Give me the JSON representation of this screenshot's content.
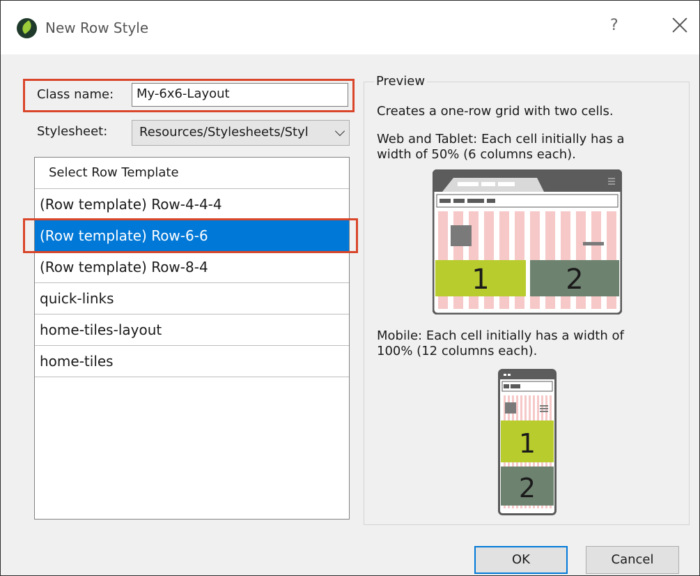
{
  "window": {
    "title": "New Row Style",
    "help_label": "?"
  },
  "form": {
    "class_name_label": "Class name:",
    "class_name_value": "My-6x6-Layout",
    "stylesheet_label": "Stylesheet:",
    "stylesheet_value": "Resources/Stylesheets/Styl"
  },
  "template_list": {
    "header": "Select Row Template",
    "items": [
      {
        "label": "(Row template) Row-4-4-4",
        "selected": false
      },
      {
        "label": "(Row template) Row-6-6",
        "selected": true
      },
      {
        "label": "(Row template) Row-8-4",
        "selected": false
      },
      {
        "label": "quick-links",
        "selected": false
      },
      {
        "label": "home-tiles-layout",
        "selected": false
      },
      {
        "label": "home-tiles",
        "selected": false
      }
    ]
  },
  "preview": {
    "legend": "Preview",
    "description": "Creates a one-row grid with two cells.",
    "web_line1": "Web and Tablet: Each cell initially has a",
    "web_line2": "width of 50% (6 columns each).",
    "mobile_line1": "Mobile: Each cell initially has a width of",
    "mobile_line2": "100% (12 columns each).",
    "cell_1": "1",
    "cell_2": "2"
  },
  "buttons": {
    "ok": "OK",
    "cancel": "Cancel"
  },
  "colors": {
    "highlight": "#d9462a",
    "selection": "#0078d7",
    "cell_1": "#b8cc2e",
    "cell_2": "#6e8270",
    "grid_stripe": "#f6c8c8"
  }
}
